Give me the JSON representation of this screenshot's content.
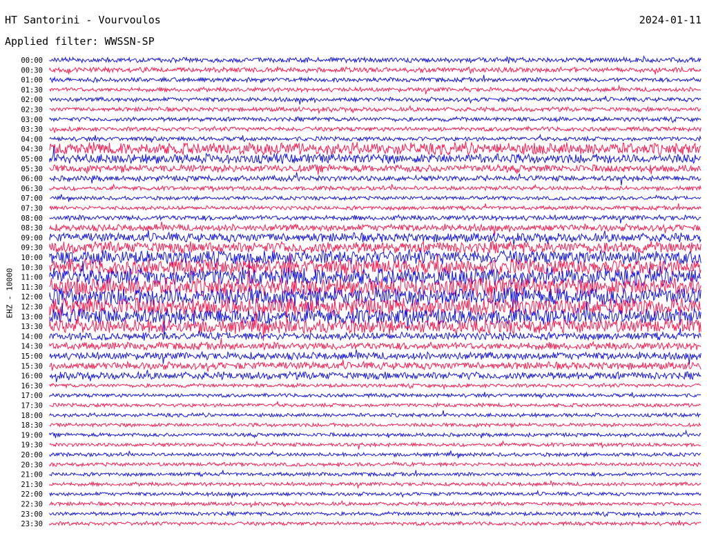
{
  "header": {
    "station": "HT Santorini - Vourvoulos",
    "date": "2024-01-11",
    "filter": "Applied filter: WWSSN-SP"
  },
  "channel_label": "EHZ - 10000",
  "colors": {
    "trace_a": "#1414e6",
    "trace_b": "#ff1a4f",
    "background": "#ffffff"
  },
  "time_labels": [
    "00:00",
    "00:30",
    "01:00",
    "01:30",
    "02:00",
    "02:30",
    "03:00",
    "03:30",
    "04:00",
    "04:30",
    "05:00",
    "05:30",
    "06:00",
    "06:30",
    "07:00",
    "07:30",
    "08:00",
    "08:30",
    "09:00",
    "09:30",
    "10:00",
    "10:30",
    "11:00",
    "11:30",
    "12:00",
    "12:30",
    "13:00",
    "13:30",
    "14:00",
    "14:30",
    "15:00",
    "15:30",
    "16:00",
    "16:30",
    "17:00",
    "17:30",
    "18:00",
    "18:30",
    "19:00",
    "19:30",
    "20:00",
    "20:30",
    "21:00",
    "21:30",
    "22:00",
    "22:30",
    "23:00",
    "23:30"
  ]
}
